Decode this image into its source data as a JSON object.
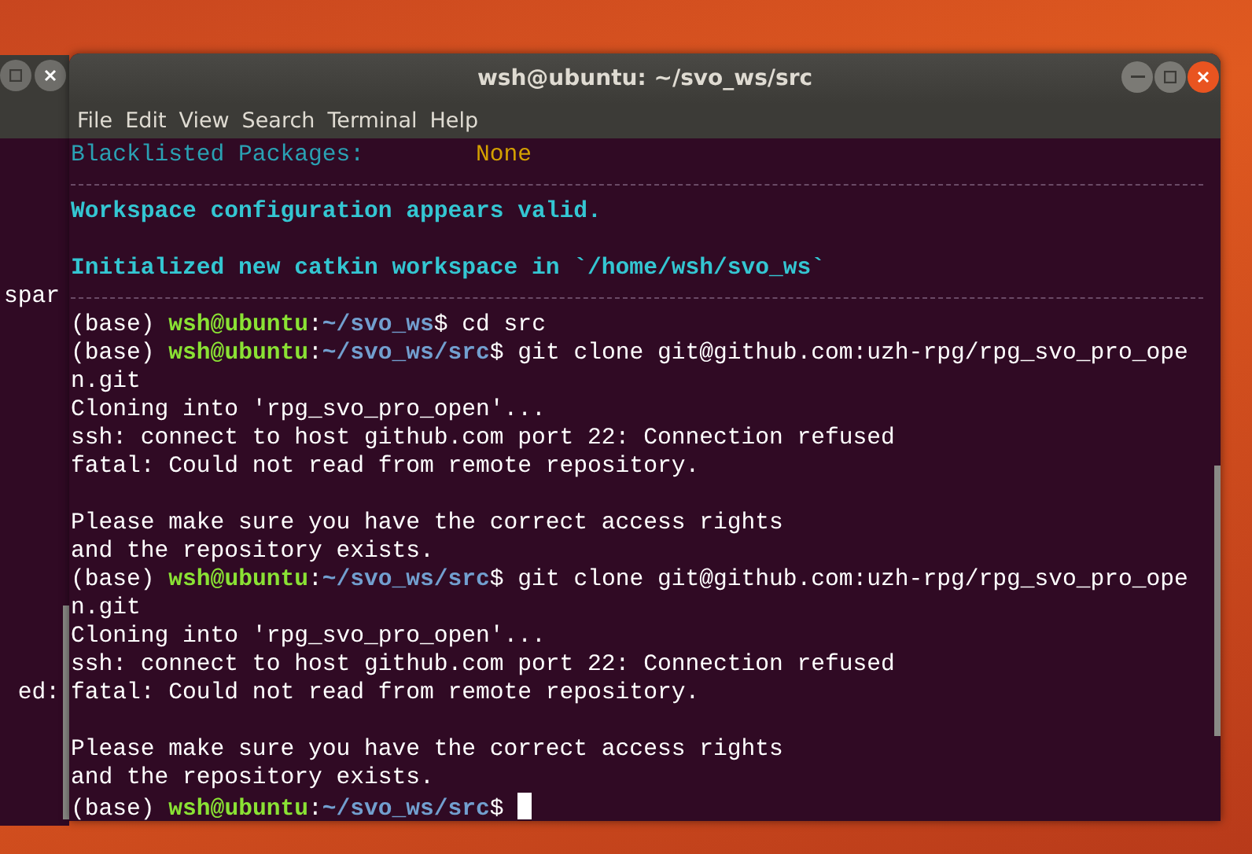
{
  "back_window": {
    "fragments": [
      "spar",
      "ed:"
    ]
  },
  "window": {
    "title": "wsh@ubuntu: ~/svo_ws/src"
  },
  "menu": [
    "File",
    "Edit",
    "View",
    "Search",
    "Terminal",
    "Help"
  ],
  "terminal_lines": [
    {
      "kind": "text",
      "segments": [
        {
          "kind": "label",
          "text": "Blacklisted Packages:        "
        },
        {
          "kind": "value",
          "text": "None"
        }
      ]
    },
    {
      "kind": "rule"
    },
    {
      "kind": "text",
      "segments": [
        {
          "kind": "heading",
          "text": "Workspace configuration appears valid."
        }
      ]
    },
    {
      "kind": "blank"
    },
    {
      "kind": "text",
      "segments": [
        {
          "kind": "heading",
          "text": "Initialized new catkin workspace in `/home/wsh/svo_ws`"
        }
      ]
    },
    {
      "kind": "rule"
    },
    {
      "kind": "text",
      "segments": [
        {
          "kind": "plain",
          "text": "(base) "
        },
        {
          "kind": "user",
          "text": "wsh@ubuntu"
        },
        {
          "kind": "plain",
          "text": ":"
        },
        {
          "kind": "path",
          "text": "~/svo_ws"
        },
        {
          "kind": "plain",
          "text": "$ cd src"
        }
      ]
    },
    {
      "kind": "text",
      "segments": [
        {
          "kind": "plain",
          "text": "(base) "
        },
        {
          "kind": "user",
          "text": "wsh@ubuntu"
        },
        {
          "kind": "plain",
          "text": ":"
        },
        {
          "kind": "path",
          "text": "~/svo_ws/src"
        },
        {
          "kind": "plain",
          "text": "$ git clone git@github.com:uzh-rpg/rpg_svo_pro_ope"
        }
      ]
    },
    {
      "kind": "text",
      "segments": [
        {
          "kind": "plain",
          "text": "n.git"
        }
      ]
    },
    {
      "kind": "text",
      "segments": [
        {
          "kind": "plain",
          "text": "Cloning into 'rpg_svo_pro_open'..."
        }
      ]
    },
    {
      "kind": "text",
      "segments": [
        {
          "kind": "plain",
          "text": "ssh: connect to host github.com port 22: Connection refused"
        }
      ]
    },
    {
      "kind": "text",
      "segments": [
        {
          "kind": "plain",
          "text": "fatal: Could not read from remote repository."
        }
      ]
    },
    {
      "kind": "blank"
    },
    {
      "kind": "text",
      "segments": [
        {
          "kind": "plain",
          "text": "Please make sure you have the correct access rights"
        }
      ]
    },
    {
      "kind": "text",
      "segments": [
        {
          "kind": "plain",
          "text": "and the repository exists."
        }
      ]
    },
    {
      "kind": "text",
      "segments": [
        {
          "kind": "plain",
          "text": "(base) "
        },
        {
          "kind": "user",
          "text": "wsh@ubuntu"
        },
        {
          "kind": "plain",
          "text": ":"
        },
        {
          "kind": "path",
          "text": "~/svo_ws/src"
        },
        {
          "kind": "plain",
          "text": "$ git clone git@github.com:uzh-rpg/rpg_svo_pro_ope"
        }
      ]
    },
    {
      "kind": "text",
      "segments": [
        {
          "kind": "plain",
          "text": "n.git"
        }
      ]
    },
    {
      "kind": "text",
      "segments": [
        {
          "kind": "plain",
          "text": "Cloning into 'rpg_svo_pro_open'..."
        }
      ]
    },
    {
      "kind": "text",
      "segments": [
        {
          "kind": "plain",
          "text": "ssh: connect to host github.com port 22: Connection refused"
        }
      ]
    },
    {
      "kind": "text",
      "segments": [
        {
          "kind": "plain",
          "text": "fatal: Could not read from remote repository."
        }
      ]
    },
    {
      "kind": "blank"
    },
    {
      "kind": "text",
      "segments": [
        {
          "kind": "plain",
          "text": "Please make sure you have the correct access rights"
        }
      ]
    },
    {
      "kind": "text",
      "segments": [
        {
          "kind": "plain",
          "text": "and the repository exists."
        }
      ]
    },
    {
      "kind": "text",
      "cursor": true,
      "segments": [
        {
          "kind": "plain",
          "text": "(base) "
        },
        {
          "kind": "user",
          "text": "wsh@ubuntu"
        },
        {
          "kind": "plain",
          "text": ":"
        },
        {
          "kind": "path",
          "text": "~/svo_ws/src"
        },
        {
          "kind": "plain",
          "text": "$ "
        }
      ]
    }
  ]
}
